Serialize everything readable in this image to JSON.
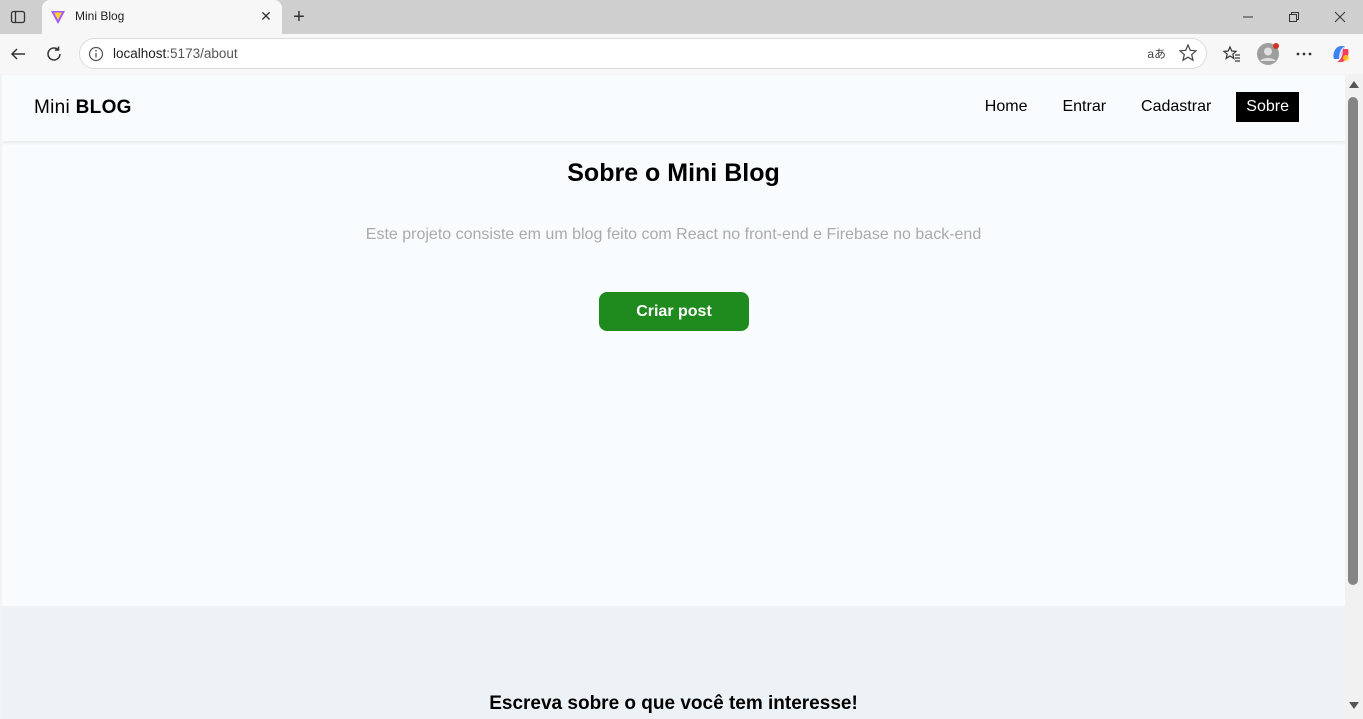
{
  "browser": {
    "tab_title": "Mini Blog",
    "url_host": "localhost",
    "url_rest": ":5173/about",
    "read_aloud_label": "aあ"
  },
  "page": {
    "brand_light": "Mini",
    "brand_bold": "BLOG",
    "nav": [
      {
        "label": "Home"
      },
      {
        "label": "Entrar"
      },
      {
        "label": "Cadastrar"
      },
      {
        "label": "Sobre"
      }
    ],
    "title": "Sobre o Mini Blog",
    "description": "Este projeto consiste em um blog feito com React no front-end e Firebase no back-end",
    "cta_label": "Criar post",
    "footer_heading": "Escreva sobre o que você tem interesse!"
  },
  "colors": {
    "cta_bg": "#1f8b1f",
    "active_nav_bg": "#000000",
    "page_bg": "#f8fcff",
    "footer_bg": "#edf2f6"
  }
}
